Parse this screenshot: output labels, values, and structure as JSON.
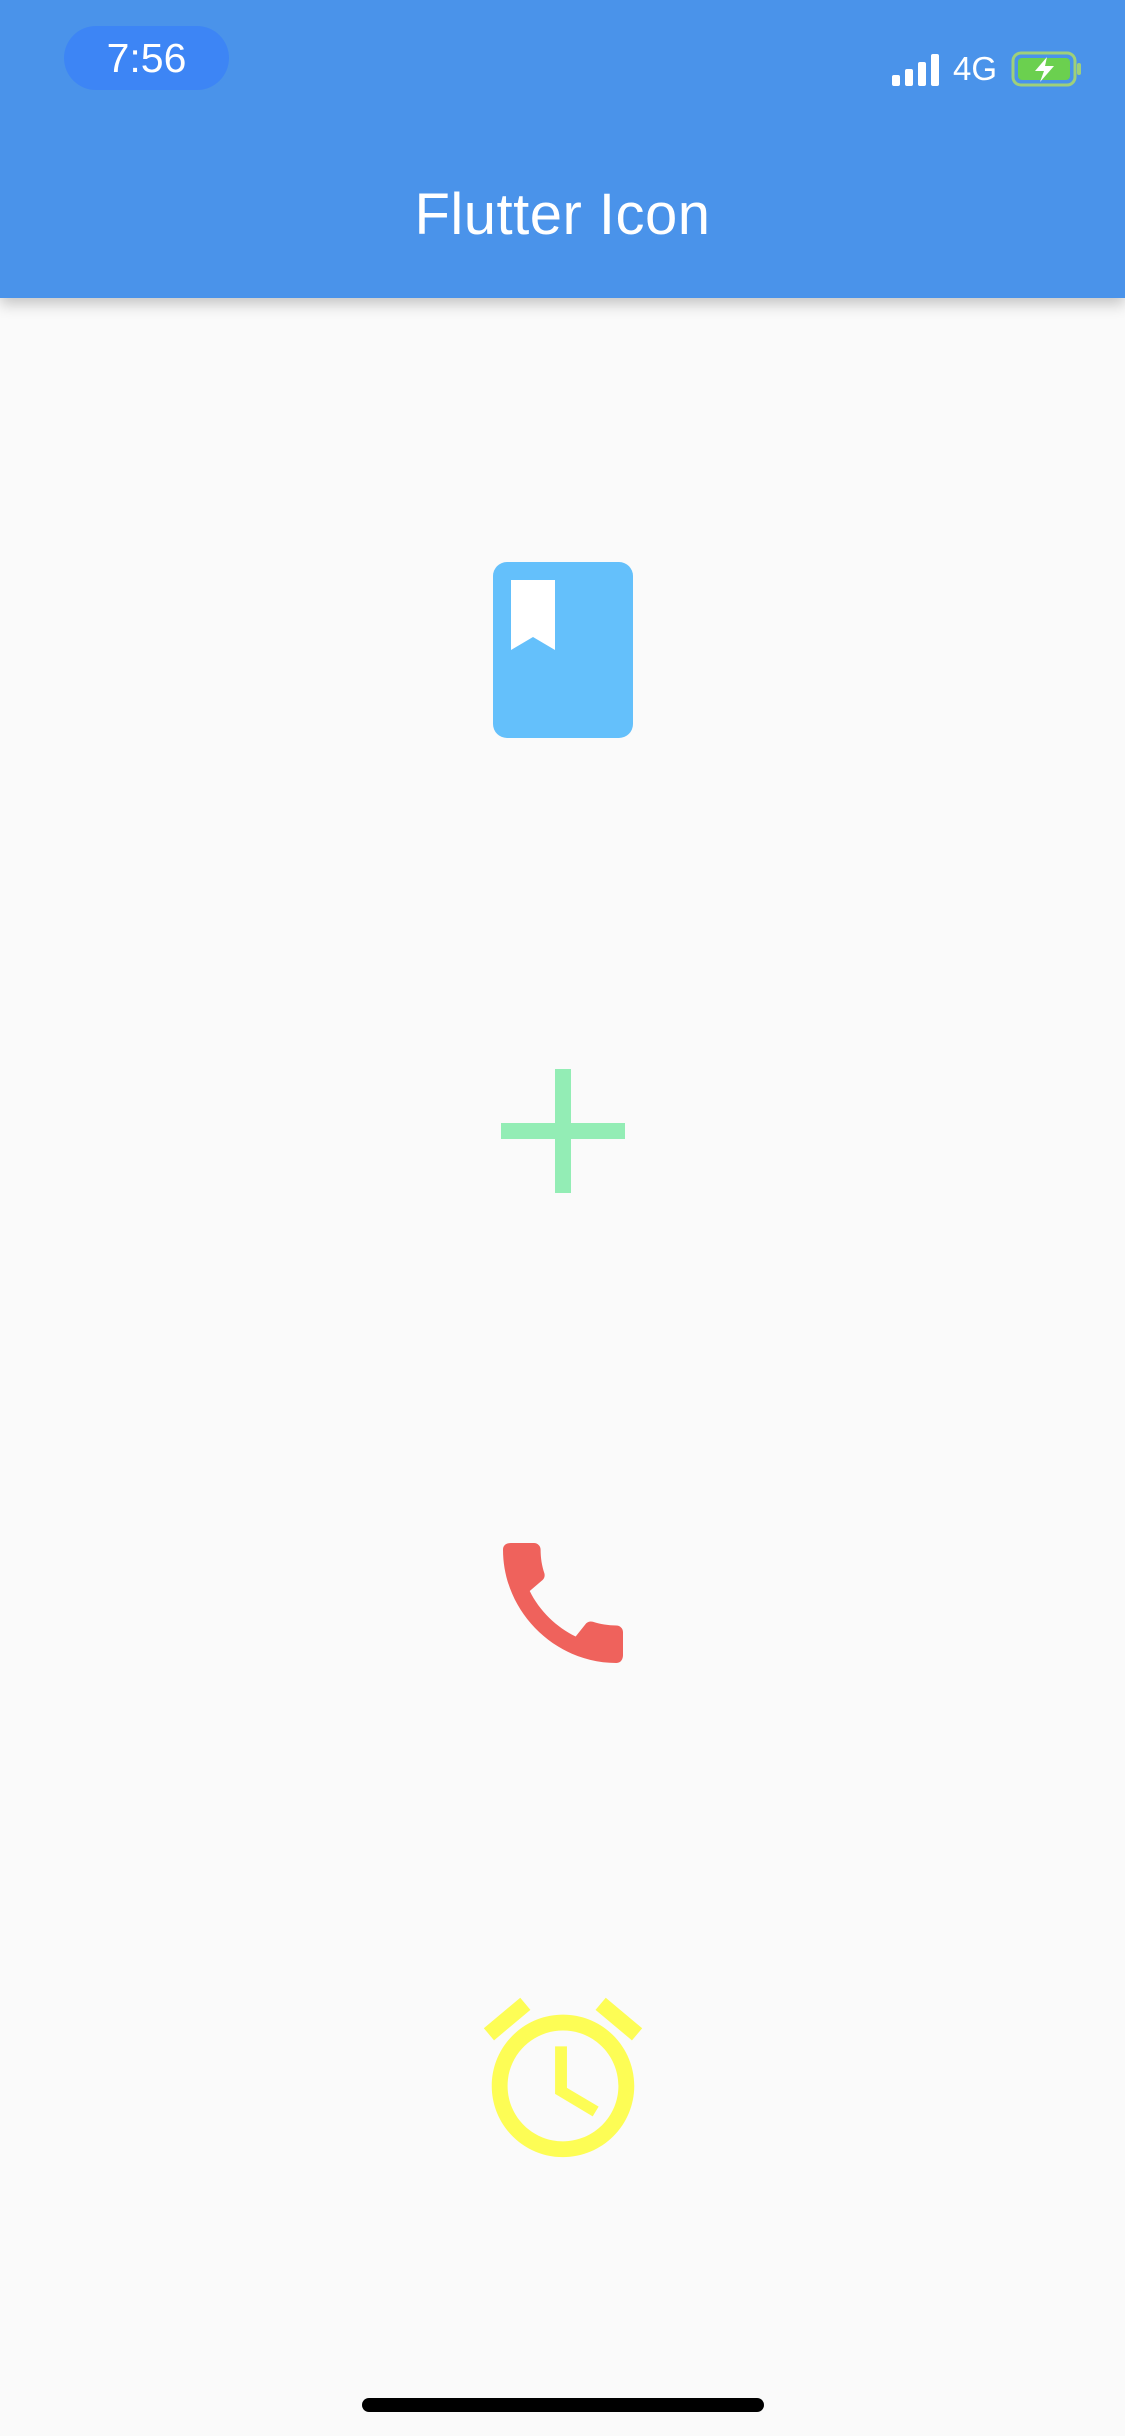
{
  "status_bar": {
    "time": "7:56",
    "network": "4G",
    "signal_icon": "cellular-signal-icon",
    "battery_icon": "battery-charging-icon"
  },
  "app_bar": {
    "title": "Flutter Icon",
    "background_color": "#4a93ea"
  },
  "icons": [
    {
      "name": "book-icon",
      "color": "#64c0fb"
    },
    {
      "name": "add-icon",
      "color": "#93edb5"
    },
    {
      "name": "phone-icon",
      "color": "#ef625c"
    },
    {
      "name": "alarm-icon",
      "color": "#fdfd55"
    }
  ]
}
